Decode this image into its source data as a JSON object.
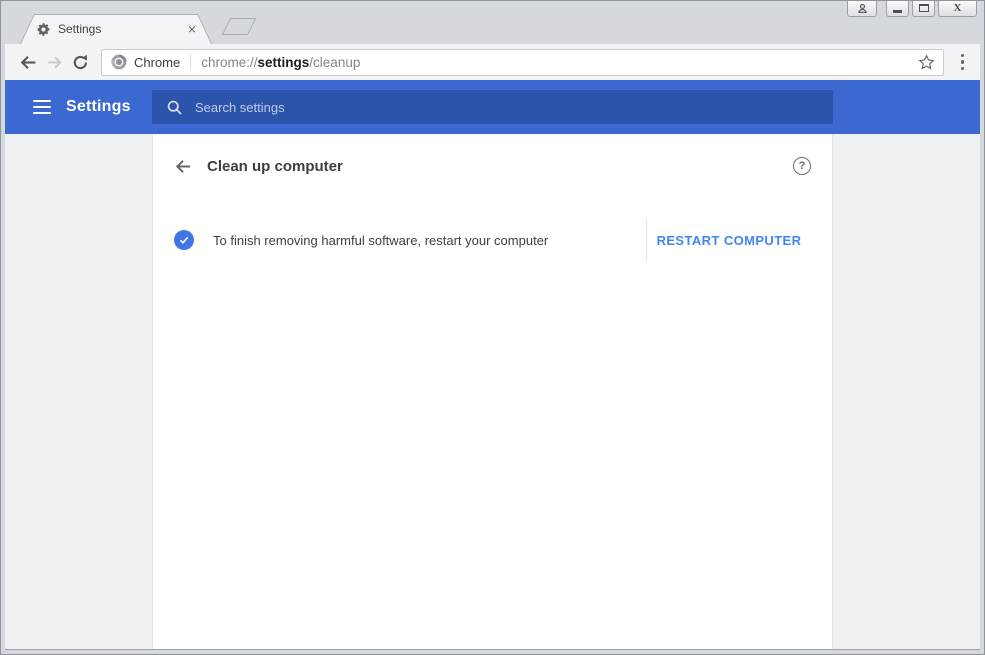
{
  "window_controls": {
    "profile_icon": "person-icon",
    "minimize_icon": "minimize-glyph",
    "maximize_icon": "maximize-glyph",
    "close_glyph": "X"
  },
  "tab": {
    "title": "Settings",
    "close_glyph": "×",
    "favicon": "gear-icon"
  },
  "toolbar": {
    "site_label": "Chrome",
    "url": {
      "scheme": "chrome://",
      "host": "settings",
      "path": "/cleanup"
    }
  },
  "settings_header": {
    "title": "Settings",
    "search_placeholder": "Search settings"
  },
  "page": {
    "title": "Clean up computer",
    "help_glyph": "?",
    "restart_row": {
      "message": "To finish removing harmful software, restart your computer",
      "button_label": "RESTART COMPUTER"
    }
  },
  "colors": {
    "header_blue": "#3B69D1",
    "search_blue": "#2D54AB",
    "accent_blue": "#4285F4",
    "check_blue": "#3F76E4",
    "frame_fill": "#D5D8DC",
    "frame_border": "#8F949B"
  }
}
